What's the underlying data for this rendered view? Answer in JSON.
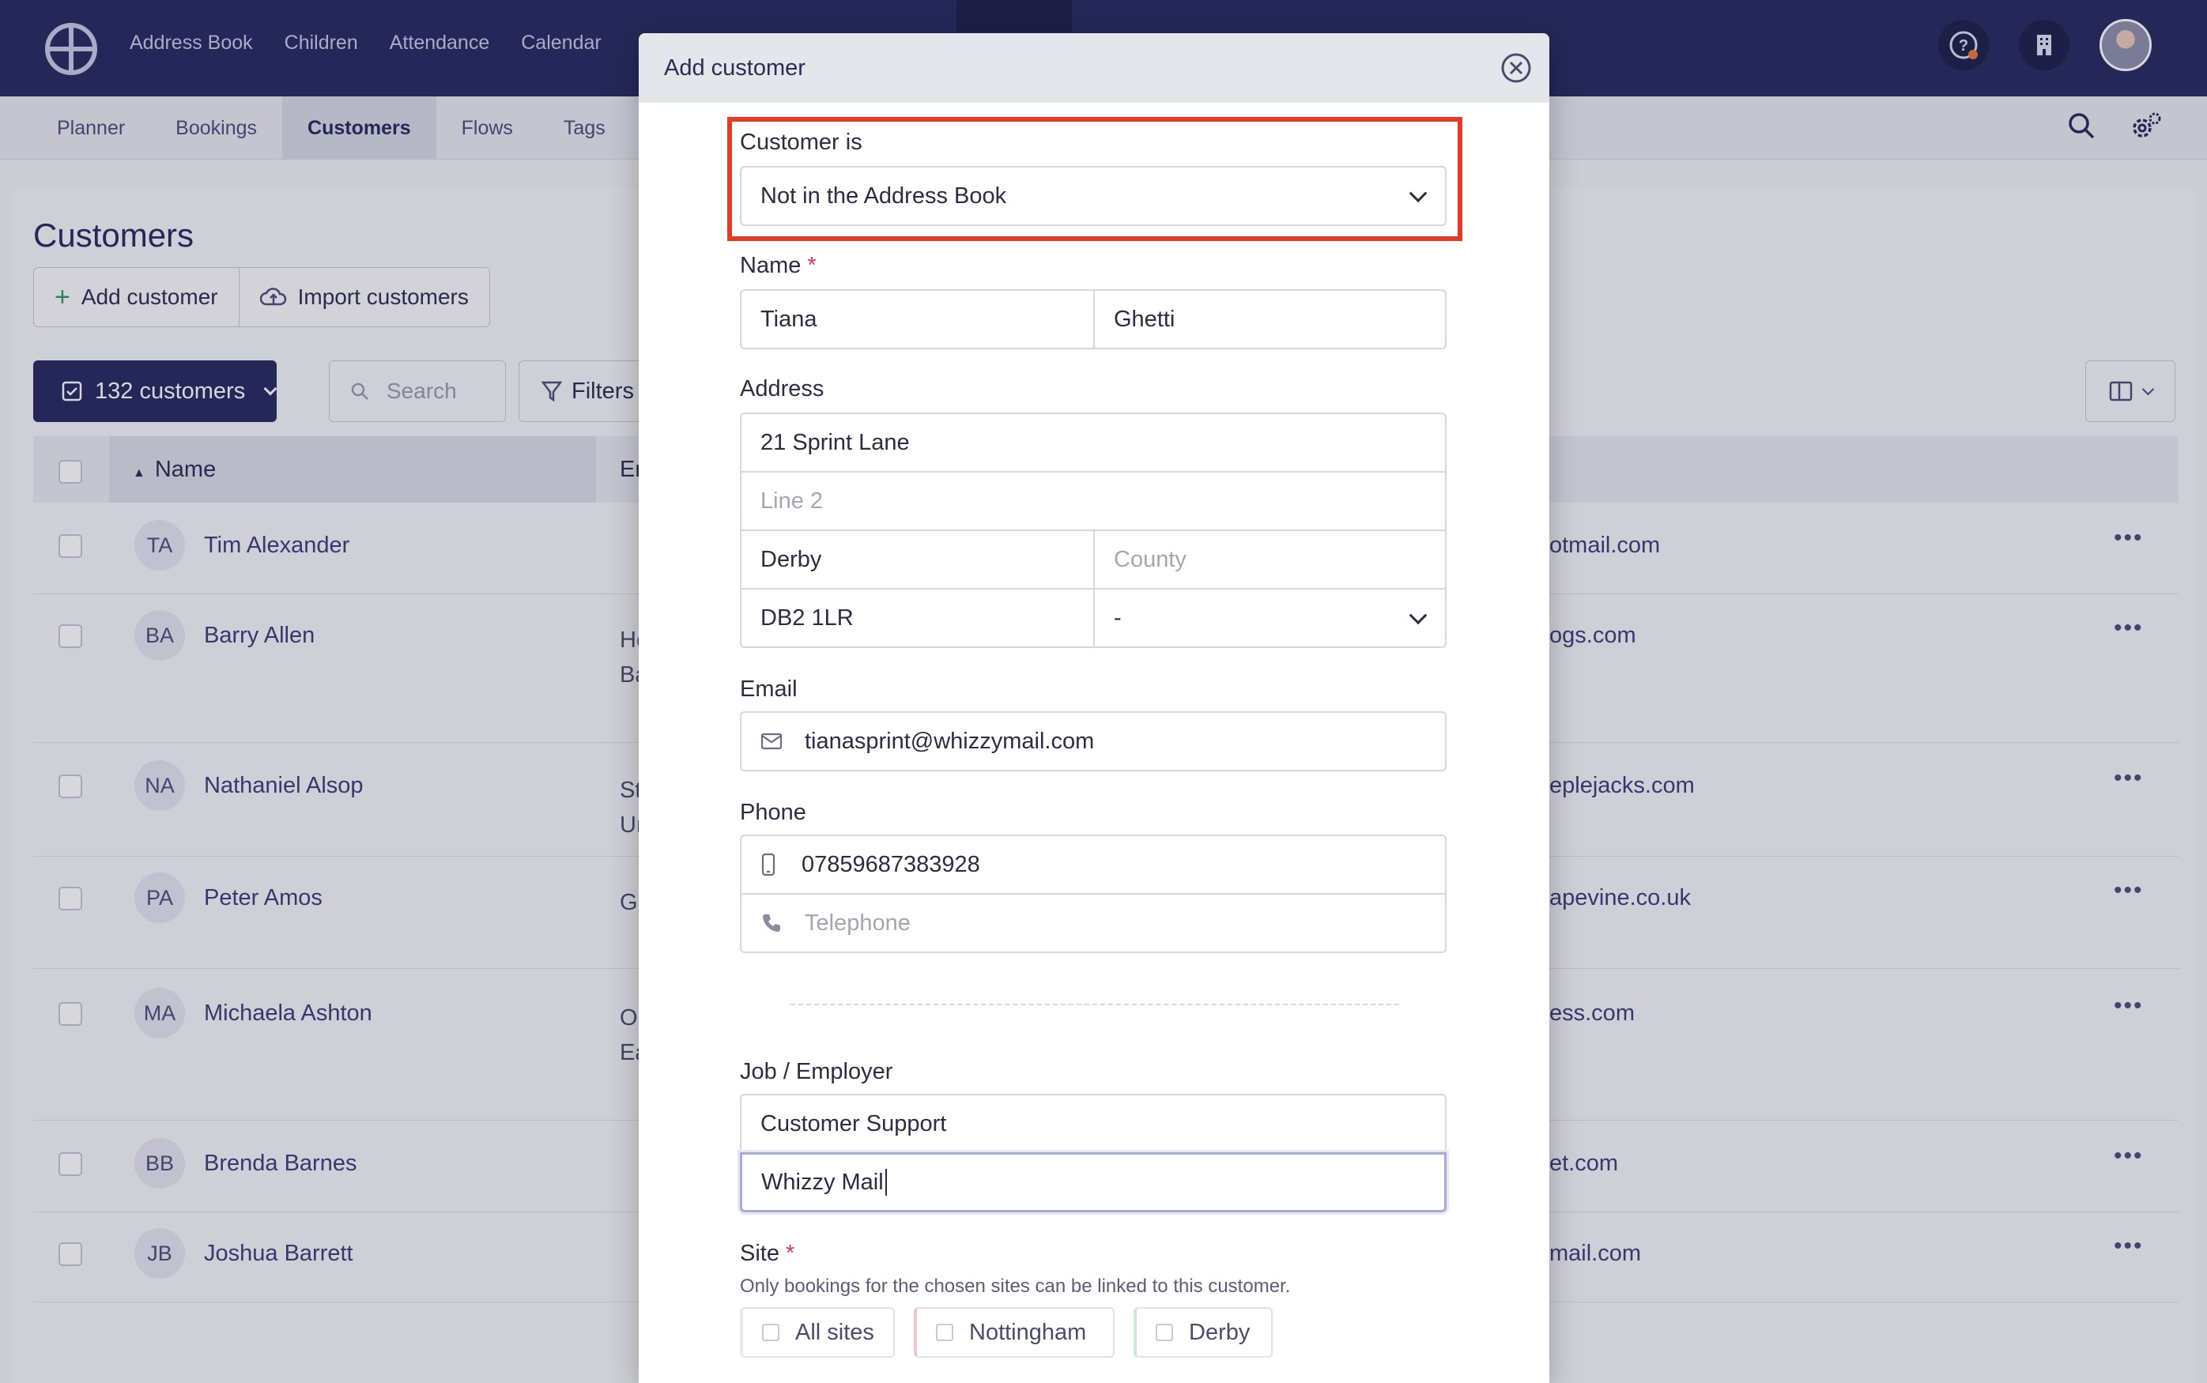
{
  "topnav": {
    "items": [
      "Address Book",
      "Children",
      "Attendance",
      "Calendar"
    ]
  },
  "subnav": {
    "tabs": [
      "Planner",
      "Bookings",
      "Customers",
      "Flows",
      "Tags"
    ],
    "active": "Customers"
  },
  "page": {
    "title": "Customers",
    "add_label": "Add customer",
    "import_label": "Import customers",
    "count_label": "132 customers",
    "search_placeholder": "Search",
    "filters_label": "Filters"
  },
  "table": {
    "col_name": "Name",
    "col_email_partial": "Er",
    "rows": [
      {
        "initials": "TA",
        "name": "Tim Alexander",
        "mid": "",
        "email": "otmail.com"
      },
      {
        "initials": "BA",
        "name": "Barry Allen",
        "mid": "He Ba",
        "email": "ogs.com"
      },
      {
        "initials": "NA",
        "name": "Nathaniel Alsop",
        "mid": "St Ur",
        "email": "eplejacks.com"
      },
      {
        "initials": "PA",
        "name": "Peter Amos",
        "mid": "Gr",
        "email": "apevine.co.uk"
      },
      {
        "initials": "MA",
        "name": "Michaela Ashton",
        "mid": "Or Ea",
        "email": "ess.com"
      },
      {
        "initials": "BB",
        "name": "Brenda Barnes",
        "mid": "",
        "email": "et.com"
      },
      {
        "initials": "JB",
        "name": "Joshua Barrett",
        "mid": "",
        "email": "mail.com"
      }
    ]
  },
  "modal": {
    "title": "Add customer",
    "customer_is": {
      "label": "Customer is",
      "value": "Not in the Address Book"
    },
    "name": {
      "label": "Name",
      "required_mark": "*",
      "first": "Tiana",
      "last": "Ghetti"
    },
    "address": {
      "label": "Address",
      "line1": "21 Sprint Lane",
      "line2_placeholder": "Line 2",
      "city": "Derby",
      "county_placeholder": "County",
      "postcode": "DB2 1LR",
      "country": "-"
    },
    "email": {
      "label": "Email",
      "value": "tianasprint@whizzymail.com"
    },
    "phone": {
      "label": "Phone",
      "mobile": "07859687383928",
      "telephone_placeholder": "Telephone"
    },
    "job": {
      "label": "Job / Employer",
      "job_title": "Customer Support",
      "employer": "Whizzy Mail"
    },
    "site": {
      "label": "Site",
      "required_mark": "*",
      "hint": "Only bookings for the chosen sites can be linked to this customer.",
      "options": [
        "All sites",
        "Nottingham",
        "Derby"
      ]
    }
  },
  "colors": {
    "navy": "#27295f",
    "highlight": "#e23c26",
    "required": "#d9384a"
  }
}
